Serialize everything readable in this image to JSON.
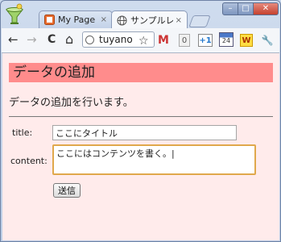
{
  "tabs": [
    {
      "label": "My Page",
      "close": "×"
    },
    {
      "label": "サンプルレ",
      "close": "×"
    }
  ],
  "window_controls": {
    "minimize": "–",
    "maximize": "□",
    "close": "✕"
  },
  "toolbar": {
    "back": "←",
    "forward": "→",
    "reload": "C",
    "home": "⌂",
    "address": "tuyano",
    "bookmark_star": "☆",
    "extensions": {
      "gmail": "M",
      "counter": "0",
      "plus_one": "+1",
      "calendar_day": "24",
      "w_ext": "W",
      "wrench": "🔧"
    }
  },
  "page": {
    "heading": "データの追加",
    "description": "データの追加を行います。",
    "form": {
      "title_label": "title:",
      "title_value": "ここにタイトル",
      "content_label": "content:",
      "content_value": "ここにはコンテンツを書く。|",
      "submit_label": "送信"
    }
  },
  "colors": {
    "heading_bg": "#ff8c8c",
    "page_bg": "#ffebeb",
    "focus_border": "#e0a84c"
  }
}
